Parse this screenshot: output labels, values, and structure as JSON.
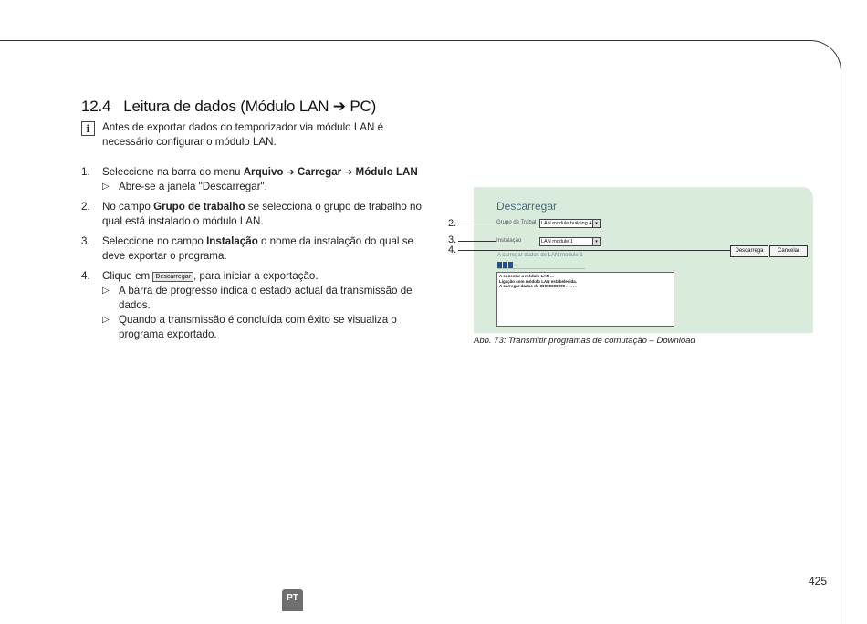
{
  "section": {
    "number": "12.4",
    "title": "Leitura de dados (Módulo LAN ➔ PC)"
  },
  "info": {
    "icon": "info-icon",
    "icon_glyph": "i",
    "text": "Antes de exportar dados do temporizador via módulo LAN é necessário configurar o módulo LAN."
  },
  "steps": {
    "s1": {
      "num": "1.",
      "pre": "Seleccione na barra do menu ",
      "menu1": "Arquivo",
      "sep": " ➔ ",
      "menu2": "Carregar",
      "menu3": "Módulo LAN",
      "result": "Abre-se a janela \"Descarregar\"."
    },
    "s2": {
      "num": "2.",
      "pre": "No campo ",
      "bold": "Grupo de trabalho",
      "post": " se selecciona o grupo de trabalho no qual está instalado o módulo LAN."
    },
    "s3": {
      "num": "3.",
      "pre": "Seleccione no campo ",
      "bold": "Instalação",
      "post": " o nome da instalação do qual se deve exportar o programa."
    },
    "s4": {
      "num": "4.",
      "pre": "Clique em ",
      "button": "Descarregar",
      "post": ", para iniciar a exportação.",
      "result1": "A barra de progresso indica o estado actual da transmissão de dados.",
      "result2": "Quando a transmissão é concluída com êxito se visualiza o programa exportado."
    },
    "result_marker": "▷"
  },
  "figure": {
    "dialog_title": "Descarregar",
    "group_label": "Grupo de Trabal",
    "group_value": "LAN module building A",
    "install_label": "Instalação",
    "install_value": "LAN module 1",
    "status_label": "A carregar dados de LAN module 1",
    "progress": 0.2,
    "log_lines": [
      "A conectar a módulo LAN ...",
      "Ligação com módulo LAN estabelecida.",
      "A carregar dados de 00000000009 . . . . ."
    ],
    "download_button": "Descarrega",
    "cancel_button": "Cancelar",
    "callouts": [
      "2.",
      "3.",
      "4."
    ],
    "dropdown_glyph": "▾",
    "caption": "Abb. 73:  Transmitir programas de comutação – Download",
    "bg_color": "#d9ebdb",
    "progress_color": "#1f4fa8"
  },
  "footer": {
    "page_number": "425",
    "language": "PT"
  }
}
